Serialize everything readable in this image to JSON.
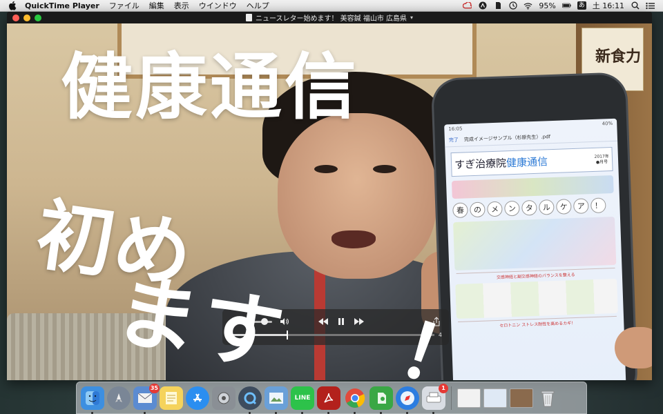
{
  "menubar": {
    "app_name": "QuickTime Player",
    "menus": [
      "ファイル",
      "編集",
      "表示",
      "ウインドウ",
      "ヘルプ"
    ],
    "battery": "95%",
    "input_method": "あ",
    "clock": "土 16:11"
  },
  "window": {
    "title": "ニュースレター始めます！ 美容鍼 福山市 広島県"
  },
  "video": {
    "overlay_title": "健康通信",
    "overlay_line1": "初め",
    "overlay_line2": "ます",
    "overlay_excl": "！",
    "book_text": "新食力",
    "phone": {
      "status_time": "16:05",
      "status_battery": "40%",
      "nav_back": "完了",
      "nav_title": "完成イメージサンプル（杉原先生）.pdf",
      "doc_title_plain": "すぎ治療院",
      "doc_title_highlight": "健康通信",
      "doc_year": "2017年",
      "doc_issue": "●月号",
      "heading_chars": [
        "春",
        "の",
        "メ",
        "ン",
        "タ",
        "ル",
        "ケ",
        "ア",
        "！"
      ],
      "section_text": "交感神経と副交感神経のバランスを整える",
      "section_text2": "セロトニン ストレス耐性を高めるカギ！"
    }
  },
  "controls": {
    "time_right": "4"
  },
  "dock": {
    "items": [
      {
        "name": "finder",
        "color": "#3d8fe0",
        "running": true
      },
      {
        "name": "launchpad",
        "color": "#7a8696",
        "running": false
      },
      {
        "name": "mail",
        "color": "#5b8bd1",
        "running": true,
        "badge": "35"
      },
      {
        "name": "notes",
        "color": "#f5d35c",
        "running": false
      },
      {
        "name": "app-store",
        "color": "#2b8ef0",
        "running": false
      },
      {
        "name": "system-preferences",
        "color": "#8a8f95",
        "running": false
      },
      {
        "name": "quicktime",
        "color": "#3d4c5e",
        "running": true
      },
      {
        "name": "preview",
        "color": "#6aa0d8",
        "running": true
      },
      {
        "name": "line",
        "color": "#2dc24a",
        "running": true,
        "label": "LINE"
      },
      {
        "name": "acrobat",
        "color": "#b3211c",
        "running": true
      },
      {
        "name": "chrome",
        "color": "#e24a3b",
        "running": true
      },
      {
        "name": "evernote",
        "color": "#3aa745",
        "running": true
      },
      {
        "name": "safari",
        "color": "#2c7de0",
        "running": true
      },
      {
        "name": "printer",
        "color": "#d9dde3",
        "running": true,
        "badge": "1"
      }
    ],
    "trash_color": "#cfd3d8"
  }
}
